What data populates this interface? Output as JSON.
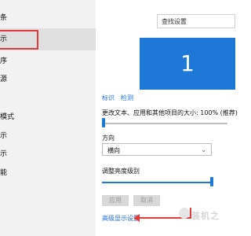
{
  "left_nav": {
    "items": [
      {
        "label": "条"
      },
      {
        "label": "示"
      },
      {
        "label": "序"
      },
      {
        "label": "源"
      },
      {
        "label": "模式"
      },
      {
        "label": "示"
      },
      {
        "label": "示"
      },
      {
        "label": "能"
      }
    ]
  },
  "search": {
    "placeholder": "查找设置"
  },
  "monitor": {
    "label": "1"
  },
  "actions": {
    "identify": "标识",
    "detect": "检测"
  },
  "scale": {
    "label": "更改文本、应用和其他项目的大小: 100% (推荐)"
  },
  "orientation": {
    "label": "方向",
    "value": "横向"
  },
  "brightness": {
    "label": "调整亮度级别"
  },
  "buttons": {
    "apply": "应用",
    "cancel": "取消"
  },
  "advanced_link": "高级显示设置",
  "watermark": {
    "text": "装机之"
  },
  "colors": {
    "accent": "#1e78d8",
    "highlight": "#e03a3a"
  }
}
